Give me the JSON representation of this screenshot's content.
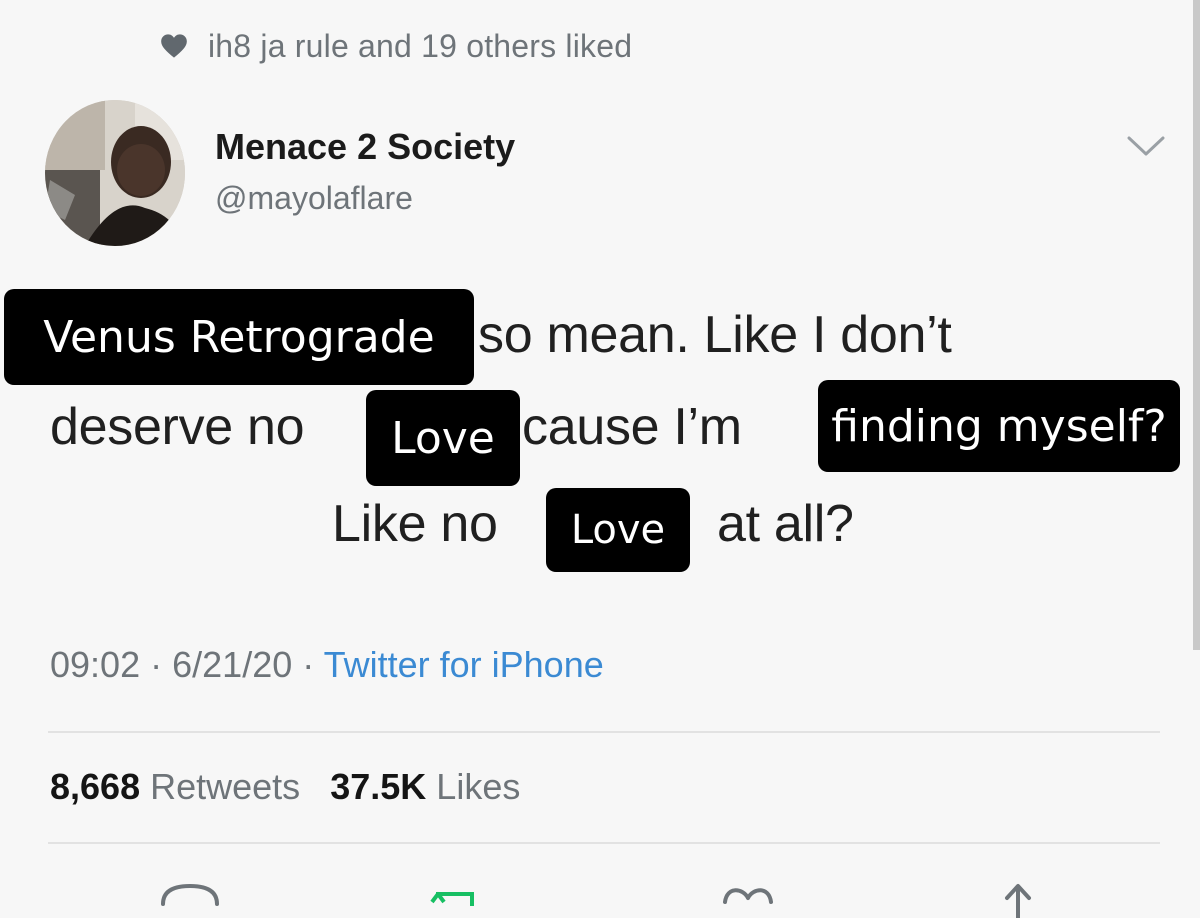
{
  "social_context": {
    "liked_text": "ih8 ja rule and 19 others liked"
  },
  "author": {
    "display_name": "Menace 2 Society",
    "handle": "@mayolaflare"
  },
  "tweet": {
    "line1": "so mean. Like I don’t",
    "line2_start": "deserve no",
    "line2_middle": "cause I’m",
    "line3_start": "Like no",
    "line3_end": "at all?"
  },
  "stickers": {
    "venus": "Venus Retrograde",
    "love1": "Love",
    "finding": "finding myself?",
    "love2": "Love"
  },
  "meta": {
    "time": "09:02",
    "date": "6/21/20",
    "separator": "·",
    "source": "Twitter for iPhone"
  },
  "stats": {
    "retweets_count": "8,668",
    "retweets_label": "Retweets",
    "likes_count": "37.5K",
    "likes_label": "Likes"
  },
  "colors": {
    "background": "#f7f7f7",
    "secondary_text": "#6e7479",
    "link_blue": "#3b8ad3",
    "sticker_bg": "#000000",
    "retweet_green": "#17bf63"
  },
  "icons": [
    "heart-icon",
    "chevron-down-icon",
    "reply-icon",
    "retweet-icon",
    "like-icon",
    "share-icon"
  ]
}
